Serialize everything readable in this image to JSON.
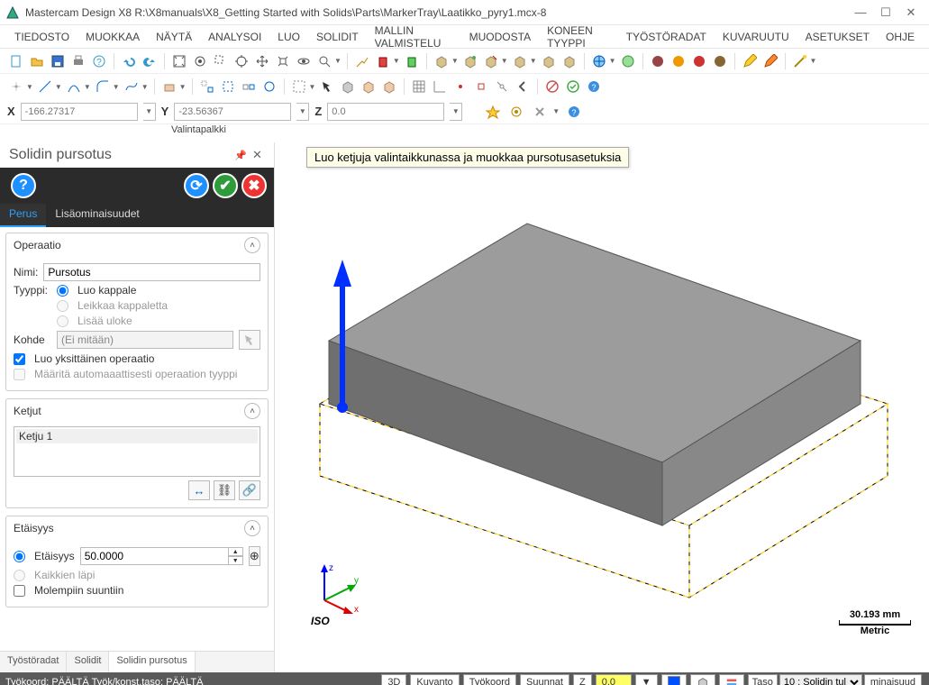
{
  "title": "Mastercam Design X8   R:\\X8manuals\\X8_Getting Started with Solids\\Parts\\MarkerTray\\Laatikko_pyry1.mcx-8",
  "menu": [
    "TIEDOSTO",
    "MUOKKAA",
    "NÄYTÄ",
    "ANALYSOI",
    "LUO",
    "SOLIDIT",
    "MALLIN VALMISTELU",
    "MUODOSTA",
    "KONEEN TYYPPI",
    "TYÖSTÖRADAT",
    "KUVARUUTU",
    "ASETUKSET",
    "OHJE"
  ],
  "coords": {
    "x_label": "X",
    "x": "-166.27317",
    "y_label": "Y",
    "y": "-23.56367",
    "z_label": "Z",
    "z": "0.0"
  },
  "hintrow": "Valintapalkki",
  "panel": {
    "title": "Solidin pursotus",
    "tabs": {
      "basic": "Perus",
      "adv": "Lisäominaisuudet"
    },
    "grp_op": "Operaatio",
    "name_label": "Nimi:",
    "name_value": "Pursotus",
    "type_label": "Tyyppi:",
    "type_opts": {
      "create": "Luo kappale",
      "cut": "Leikkaa kappaletta",
      "boss": "Lisää uloke"
    },
    "target_label": "Kohde",
    "target_value": "(Ei mitään)",
    "single_op": "Luo yksittäinen operaatio",
    "auto_type": "Määritä automaaattisesti operaation tyyppi",
    "grp_chains": "Ketjut",
    "chain_item": "Ketju 1",
    "grp_dist": "Etäisyys",
    "dist_radio": "Etäisyys",
    "dist_value": "50.0000",
    "through": "Kaikkien läpi",
    "both": "Molempiin suuntiin",
    "bottom_tabs": [
      "Työstöradat",
      "Solidit",
      "Solidin pursotus"
    ]
  },
  "viewport": {
    "tooltip": "Luo ketjuja valintaikkunassa ja muokkaa pursotusasetuksia",
    "iso": "ISO",
    "scale_value": "30.193 mm",
    "scale_unit": "Metric"
  },
  "status": {
    "left": "Työkoord: PÄÄLTÄ  Työk/konst.taso: PÄÄLTÄ",
    "btn_3d": "3D",
    "btn_view": "Kuvanto",
    "btn_wcs": "Työkoord",
    "btn_dir": "Suunnat",
    "z_label": "Z",
    "z_value": "0.0",
    "plane_label": "Taso",
    "plane_value": "10 : Solidin tul",
    "attr": "minaisuud"
  }
}
